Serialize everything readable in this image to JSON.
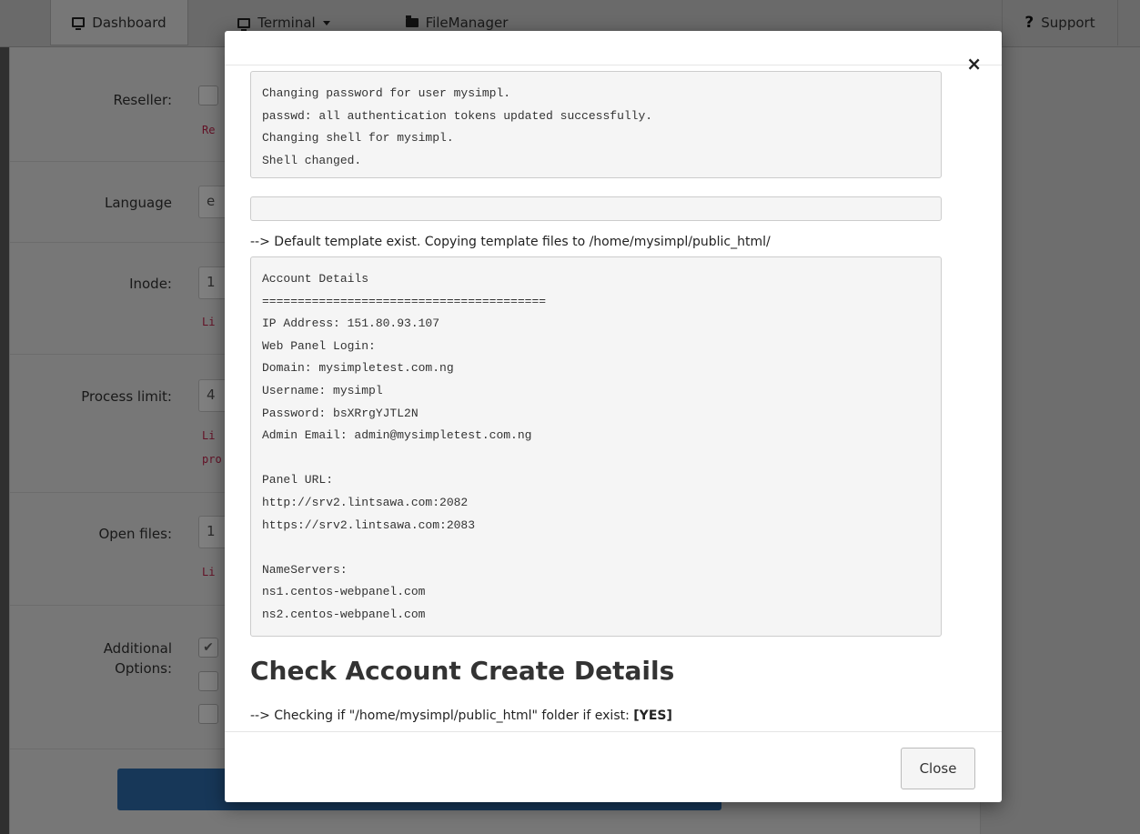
{
  "topbar": {
    "tabs": [
      {
        "label": "Dashboard",
        "icon": "monitor-icon"
      },
      {
        "label": "Terminal",
        "icon": "monitor-icon"
      },
      {
        "label": "FileManager",
        "icon": "folder-icon"
      }
    ],
    "support_label": "Support",
    "support_icon": "question-icon"
  },
  "form": {
    "rows": [
      {
        "label": "Reseller:",
        "help": "Re"
      },
      {
        "label": "Language",
        "value": "e"
      },
      {
        "label": "Inode:",
        "value": "1",
        "help": "Li"
      },
      {
        "label": "Process limit:",
        "value": "4",
        "help": "Li",
        "help2": "pro"
      },
      {
        "label": "Open files:",
        "value": "1",
        "help": "Li"
      },
      {
        "label": "Additional",
        "label2": "Options:",
        "check": "✔"
      }
    ]
  },
  "modal": {
    "close_symbol": "×",
    "output_block_1": "Changing password for user mysimpl.\npasswd: all authentication tokens updated successfully.\nChanging shell for mysimpl.\nShell changed.",
    "note_1": "--> Default template exist. Copying template files to /home/mysimpl/public_html/",
    "account_details": "Account Details\n========================================\nIP Address: 151.80.93.107\nWeb Panel Login:\nDomain: mysimpletest.com.ng\nUsername: mysimpl\nPassword: bsXRrgYJTL2N\nAdmin Email: admin@mysimpletest.com.ng\n\nPanel URL:\nhttp://srv2.lintsawa.com:2082\nhttps://srv2.lintsawa.com:2083\n\nNameServers:\nns1.centos-webpanel.com\nns2.centos-webpanel.com",
    "section_title": "Check Account Create Details",
    "check_line_prefix": "--> Checking if \"/home/mysimpl/public_html\" folder if exist: ",
    "check_line_result": "[YES]",
    "close_button": "Close"
  },
  "colors": {
    "overlay": "#000000",
    "submit_button": "#2f6fb0",
    "help_text": "#c7254e"
  }
}
